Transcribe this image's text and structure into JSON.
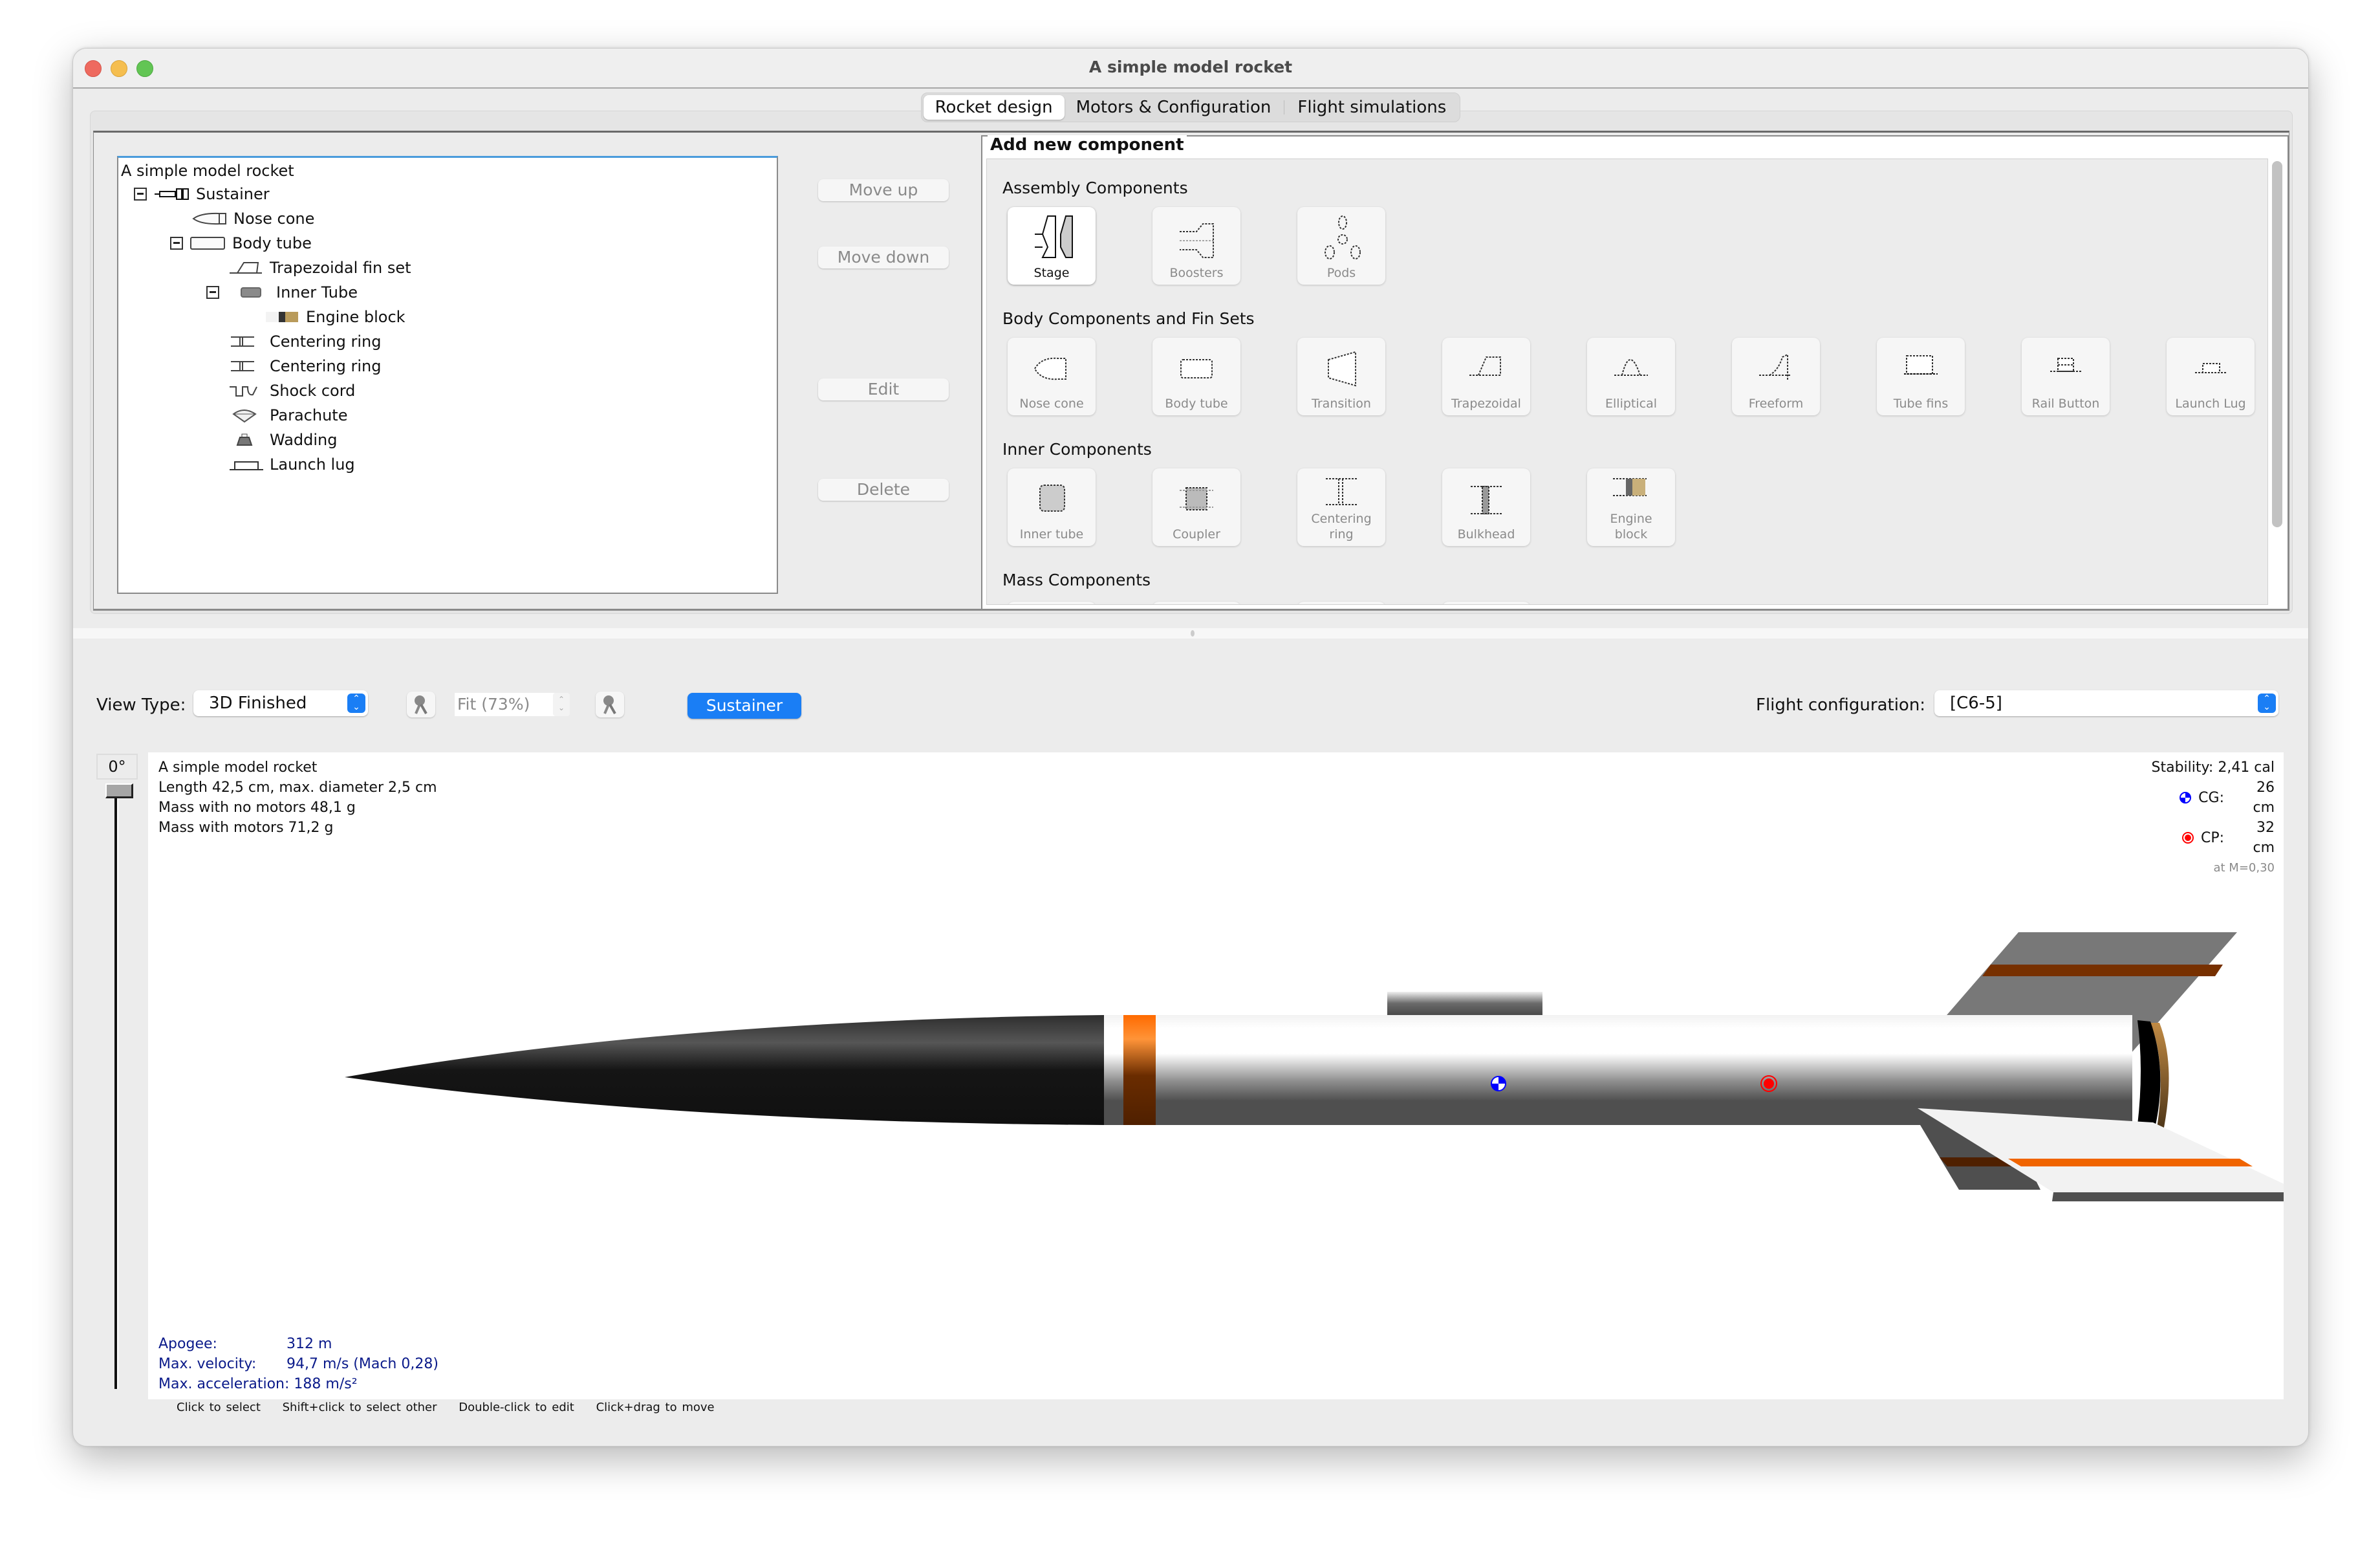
{
  "window": {
    "title": "A simple model rocket"
  },
  "tabs": [
    {
      "label": "Rocket design",
      "active": true
    },
    {
      "label": "Motors & Configuration",
      "active": false
    },
    {
      "label": "Flight simulations",
      "active": false
    }
  ],
  "tree": {
    "root": "A simple model rocket",
    "items": [
      {
        "label": "Sustainer",
        "icon": "stage-icon",
        "level": 1,
        "expanded": true
      },
      {
        "label": "Nose cone",
        "icon": "nose-cone-icon",
        "level": 2
      },
      {
        "label": "Body tube",
        "icon": "body-tube-icon",
        "level": 2,
        "expanded": true
      },
      {
        "label": "Trapezoidal fin set",
        "icon": "trapezoidal-fin-icon",
        "level": 3
      },
      {
        "label": "Inner Tube",
        "icon": "inner-tube-icon",
        "level": 3,
        "expanded": true
      },
      {
        "label": "Engine block",
        "icon": "engine-block-icon",
        "level": 4
      },
      {
        "label": "Centering ring",
        "icon": "centering-ring-icon",
        "level": 3
      },
      {
        "label": "Centering ring",
        "icon": "centering-ring-icon",
        "level": 3
      },
      {
        "label": "Shock cord",
        "icon": "shock-cord-icon",
        "level": 3
      },
      {
        "label": "Parachute",
        "icon": "parachute-icon",
        "level": 3
      },
      {
        "label": "Wadding",
        "icon": "wadding-icon",
        "level": 3
      },
      {
        "label": "Launch lug",
        "icon": "launch-lug-icon",
        "level": 3
      }
    ]
  },
  "buttons": {
    "move_up": "Move up",
    "move_down": "Move down",
    "edit": "Edit",
    "delete": "Delete"
  },
  "add_component": {
    "title": "Add new component",
    "sections": [
      {
        "title": "Assembly Components",
        "items": [
          "Stage",
          "Boosters",
          "Pods"
        ]
      },
      {
        "title": "Body Components and Fin Sets",
        "items": [
          "Nose cone",
          "Body tube",
          "Transition",
          "Trapezoidal",
          "Elliptical",
          "Freeform",
          "Tube fins",
          "Rail Button",
          "Launch Lug"
        ]
      },
      {
        "title": "Inner Components",
        "items": [
          "Inner tube",
          "Coupler",
          "Centering ring",
          "Bulkhead",
          "Engine block"
        ]
      },
      {
        "title": "Mass Components",
        "items": []
      }
    ]
  },
  "view_toolbar": {
    "view_type_label": "View Type:",
    "view_type_value": "3D Finished",
    "zoom_value": "Fit (73%)",
    "stage_button": "Sustainer",
    "flight_config_label": "Flight configuration:",
    "flight_config_value": "[C6-5]"
  },
  "figure": {
    "angle": "0°",
    "name": "A simple model rocket",
    "length_line": "Length 42,5 cm, max. diameter 2,5 cm",
    "mass_no_motors": "Mass with no motors 48,1 g",
    "mass_with_motors": "Mass with motors 71,2 g",
    "stability": "Stability: 2,41 cal",
    "cg_label": "CG:",
    "cg_value": "26 cm",
    "cp_label": "CP:",
    "cp_value": "32 cm",
    "mach": "at M=0,30",
    "apogee_label": "Apogee:",
    "apogee_value": "312 m",
    "max_velocity_label": "Max. velocity:",
    "max_velocity_value": "94,7 m/s  (Mach 0,28)",
    "max_accel_label": "Max. acceleration:",
    "max_accel_value": "188 m/s²"
  },
  "hints": [
    "Click to select",
    "Shift+click to select other",
    "Double-click to edit",
    "Click+drag to move"
  ],
  "colors": {
    "accent": "#1a7ef5",
    "cg_marker": "#0000ff",
    "cp_marker": "#ff0000",
    "fin_stripe": "#f06400",
    "nose_cone": "#141414"
  }
}
